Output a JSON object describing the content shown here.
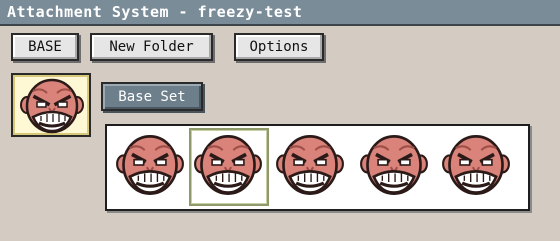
{
  "window": {
    "title": "Attachment System - freezy-test"
  },
  "toolbar": {
    "base_label": "BASE",
    "new_folder_label": "New Folder",
    "options_label": "Options"
  },
  "sets": {
    "base_set_label": "Base Set"
  },
  "icons": {
    "thumbnail": "angry-face-icon",
    "frame": "angry-face-icon"
  },
  "colors": {
    "titlebar": "#7a8c98",
    "background": "#d4ccc3",
    "face_skin": "#d9837a",
    "face_outline": "#2b1a18",
    "selection_highlight": "#fef8d4"
  },
  "strip": {
    "frames": [
      {
        "label": ""
      },
      {
        "label": "",
        "selected": true
      },
      {
        "label": ""
      },
      {
        "label": ""
      },
      {
        "label": ""
      }
    ]
  }
}
